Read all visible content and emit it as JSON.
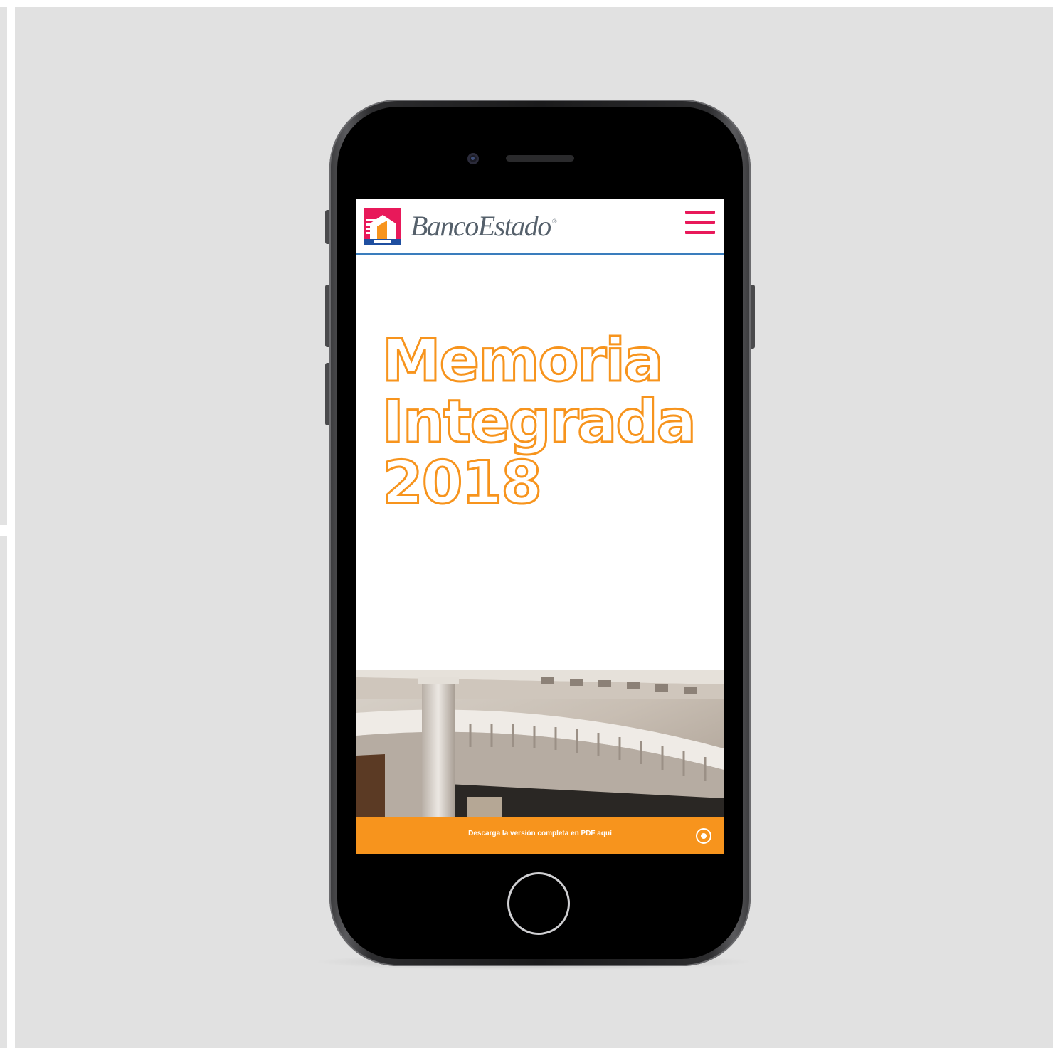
{
  "colors": {
    "background": "#e1e1e1",
    "brand_red": "#e8195a",
    "accent_orange": "#f7941d",
    "header_border": "#3a7dbd"
  },
  "header": {
    "logo_text": "BancoEstado",
    "logo_registered": "®",
    "menu_icon": "hamburger-menu-icon"
  },
  "hero": {
    "title_line1": "Memoria",
    "title_line2": "Integrada",
    "title_line3": "2018"
  },
  "download": {
    "label": "Descarga la versión completa en PDF aquí",
    "icon": "download-circle-icon"
  }
}
